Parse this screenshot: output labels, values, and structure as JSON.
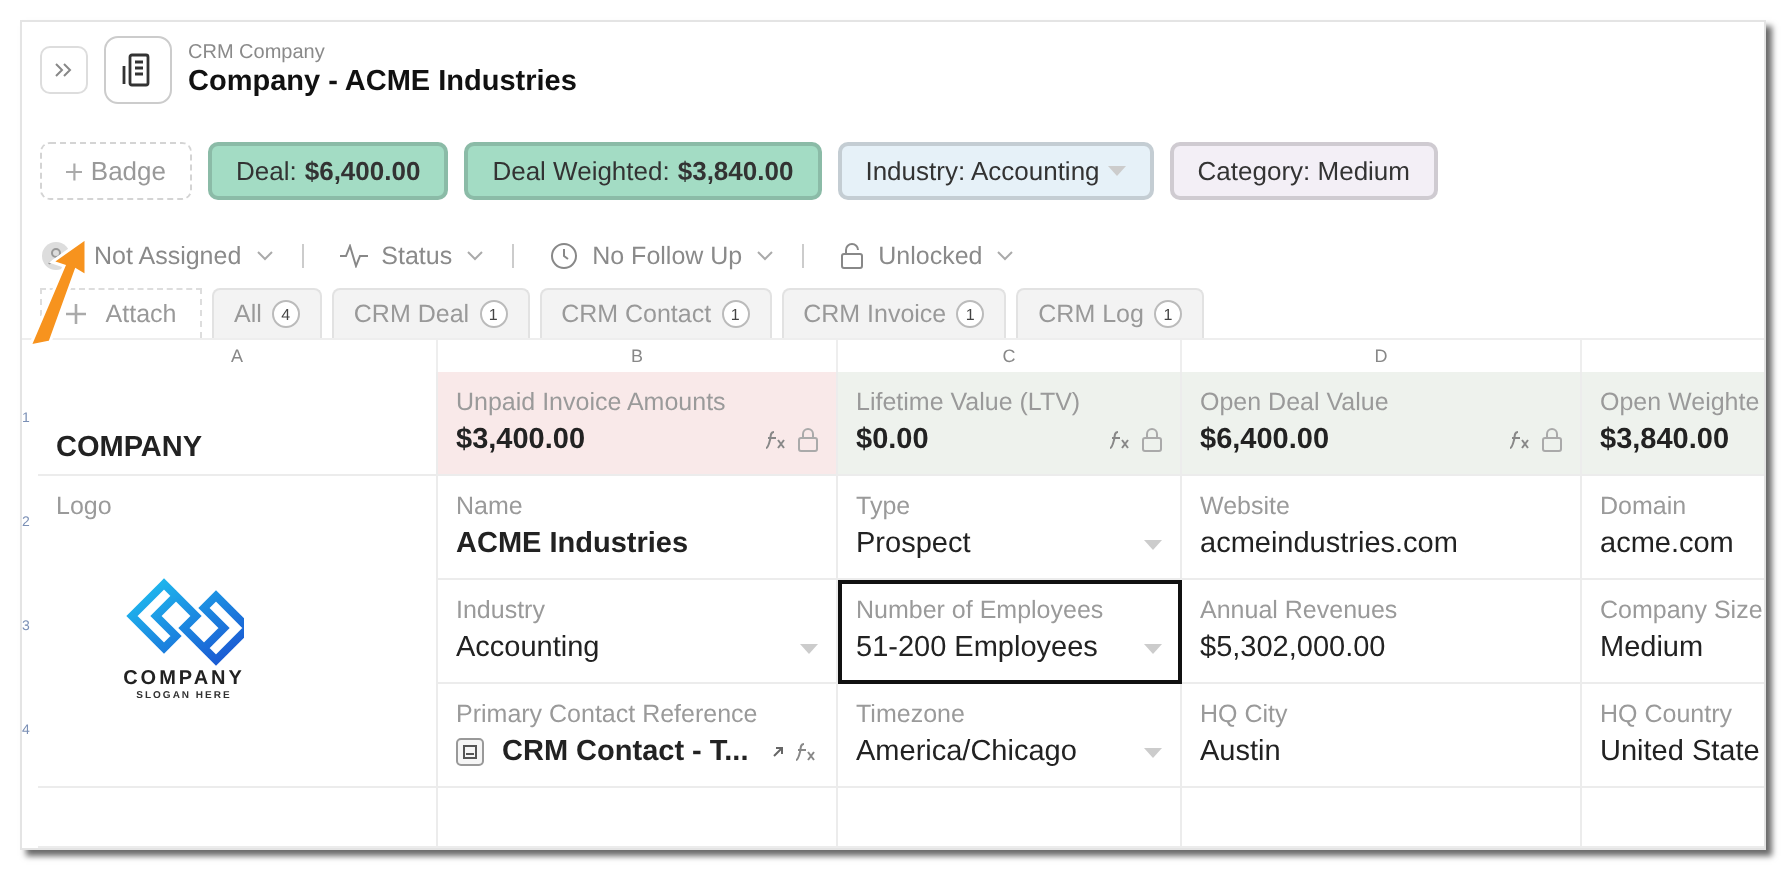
{
  "header": {
    "subtitle": "CRM Company",
    "title": "Company - ACME Industries"
  },
  "badges": [
    {
      "kind": "add",
      "label": "Badge"
    },
    {
      "kind": "value",
      "label": "Deal:",
      "value": "$6,400.00",
      "color": "#a3dcc4"
    },
    {
      "kind": "value",
      "label": "Deal Weighted:",
      "value": "$3,840.00",
      "color": "#a3dcc4"
    },
    {
      "kind": "select",
      "label": "Industry: Accounting",
      "color": "#e6f1f8"
    },
    {
      "kind": "value",
      "label": "Category: Medium",
      "color": "#f3eff6"
    }
  ],
  "toolbar": [
    {
      "kind": "avatar",
      "label": "Not Assigned"
    },
    {
      "kind": "status",
      "label": "Status"
    },
    {
      "kind": "clock",
      "label": "No Follow Up"
    },
    {
      "kind": "lock",
      "label": "Unlocked"
    }
  ],
  "attach": "Attach",
  "tabs": [
    {
      "label": "All",
      "count": "4",
      "selected": false
    },
    {
      "label": "CRM Deal",
      "count": "1",
      "selected": false
    },
    {
      "label": "CRM Contact",
      "count": "1",
      "selected": false
    },
    {
      "label": "CRM Invoice",
      "count": "1",
      "selected": false
    },
    {
      "label": "CRM Log",
      "count": "1",
      "selected": false
    }
  ],
  "columns": [
    "A",
    "B",
    "C",
    "D"
  ],
  "row_numbers": [
    "1",
    "2",
    "3",
    "4"
  ],
  "title_cell": "COMPANY",
  "logo": {
    "label": "Logo",
    "name": "COMPANY",
    "slogan": "SLOGAN HERE"
  },
  "rows": [
    [
      {
        "kind": "metric",
        "label": "Unpaid Invoice Amounts",
        "value": "$3,400.00",
        "color": "#f9e9e9",
        "formula": true,
        "selected": false
      },
      {
        "kind": "metric",
        "label": "Lifetime Value (LTV)",
        "value": "$0.00",
        "color": "#eef2ed",
        "formula": true,
        "selected": false
      },
      {
        "kind": "metric",
        "label": "Open Deal Value",
        "value": "$6,400.00",
        "color": "#eef2ed",
        "formula": true,
        "selected": false
      },
      {
        "kind": "metric",
        "label": "Open Weighte",
        "value": "$3,840.00",
        "color": "#eef2ed",
        "selected": false
      }
    ],
    [
      {
        "kind": "field",
        "label": "Name",
        "value": "ACME Industries",
        "bold": true,
        "selected": false
      },
      {
        "kind": "select",
        "label": "Type",
        "value": "Prospect",
        "selected": false
      },
      {
        "kind": "field",
        "label": "Website",
        "value": "acmeindustries.com",
        "bold": false,
        "selected": false
      },
      {
        "kind": "field",
        "label": "Domain",
        "value": "acme.com",
        "bold": false,
        "selected": false
      }
    ],
    [
      {
        "kind": "select",
        "label": "Industry",
        "value": "Accounting",
        "selected": false
      },
      {
        "kind": "select",
        "label": "Number of Employees",
        "value": "51-200 Employees",
        "selected": true
      },
      {
        "kind": "field",
        "label": "Annual Revenues",
        "value": "$5,302,000.00",
        "bold": false,
        "selected": false
      },
      {
        "kind": "field",
        "label": "Company Size",
        "value": "Medium",
        "bold": false,
        "selected": false
      }
    ],
    [
      {
        "kind": "reference",
        "label": "Primary Contact Reference",
        "value": "CRM Contact - T...",
        "selected": false
      },
      {
        "kind": "select",
        "label": "Timezone",
        "value": "America/Chicago",
        "selected": false
      },
      {
        "kind": "field",
        "label": "HQ City",
        "value": "Austin",
        "bold": false,
        "selected": false
      },
      {
        "kind": "field",
        "label": "HQ Country",
        "value": "United State",
        "bold": false,
        "selected": false
      }
    ]
  ]
}
